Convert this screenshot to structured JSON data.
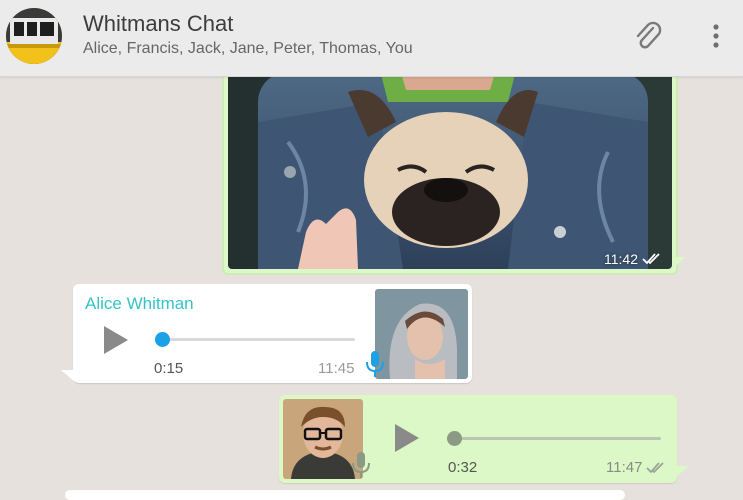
{
  "header": {
    "title": "Whitmans Chat",
    "participants": "Alice, Francis, Jack, Jane, Peter, Thomas, You",
    "group_avatar_icon": "bus-photo-avatar",
    "attach_icon": "paperclip-icon",
    "menu_icon": "more-vert-icon"
  },
  "messages": {
    "image": {
      "time": "11:42",
      "status": "read",
      "status_icon": "double-check-icon"
    },
    "voice_in": {
      "sender": "Alice Whitman",
      "duration": "0:15",
      "time": "11:45",
      "progress": 0
    },
    "voice_out": {
      "duration": "0:32",
      "time": "11:47",
      "status": "read",
      "progress": 0
    }
  },
  "colors": {
    "app_background": "#e6e1dc",
    "header_background": "#ebebeb",
    "outgoing_bubble": "#dcf8c6",
    "incoming_bubble": "#ffffff",
    "sender_name": "#35c3c7",
    "playback_accent_incoming": "#1da1e6",
    "playback_accent_outgoing": "#8a9a84",
    "mic_incoming": "#1da1e6"
  }
}
